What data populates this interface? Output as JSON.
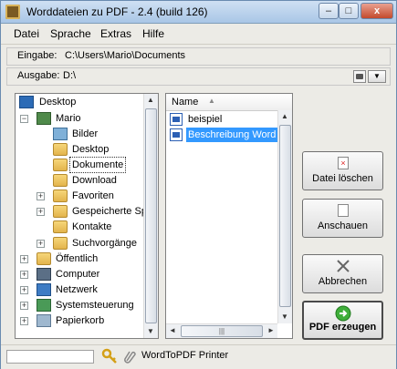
{
  "window": {
    "title": "Worddateien zu PDF - 2.4 (build 126)",
    "min_label": "–",
    "max_label": "□",
    "close_label": "x"
  },
  "menu": [
    "Datei",
    "Sprache",
    "Extras",
    "Hilfe"
  ],
  "input": {
    "label": "Eingabe:",
    "value": "C:\\Users\\Mario\\Documents"
  },
  "output": {
    "label": "Ausgabe:",
    "value": "D:\\"
  },
  "tree": [
    {
      "label": "Desktop",
      "icon": "desktop-icon"
    },
    {
      "label": "Mario",
      "icon": "user-folder-icon"
    },
    {
      "label": "Bilder",
      "icon": "pictures-folder-icon"
    },
    {
      "label": "Desktop",
      "icon": "folder-icon"
    },
    {
      "label": "Dokumente",
      "icon": "folder-icon"
    },
    {
      "label": "Download",
      "icon": "folder-icon"
    },
    {
      "label": "Favoriten",
      "icon": "favorites-folder-icon"
    },
    {
      "label": "Gespeicherte Spiele",
      "icon": "folder-icon"
    },
    {
      "label": "Kontakte",
      "icon": "contacts-folder-icon"
    },
    {
      "label": "Suchvorgänge",
      "icon": "folder-icon"
    },
    {
      "label": "Öffentlich",
      "icon": "folder-icon"
    },
    {
      "label": "Computer",
      "icon": "computer-icon"
    },
    {
      "label": "Netzwerk",
      "icon": "network-icon"
    },
    {
      "label": "Systemsteuerung",
      "icon": "control-panel-icon"
    },
    {
      "label": "Papierkorb",
      "icon": "recycle-bin-icon"
    }
  ],
  "filelist": {
    "column": "Name",
    "sort_arrow": "▲",
    "items": [
      "beispiel",
      "Beschreibung Word"
    ]
  },
  "buttons": {
    "delete": "Datei löschen",
    "view": "Anschauen",
    "cancel": "Abbrechen",
    "create": "PDF erzeugen"
  },
  "status": {
    "printer": "WordToPDF Printer"
  },
  "glyphs": {
    "minus": "−",
    "plus": "+",
    "up": "▲",
    "down": "▼",
    "left": "◄",
    "right": "►",
    "grip": "|||"
  },
  "colors": {
    "selection": "#3399ff",
    "titlebar": "#a9c6e6"
  }
}
